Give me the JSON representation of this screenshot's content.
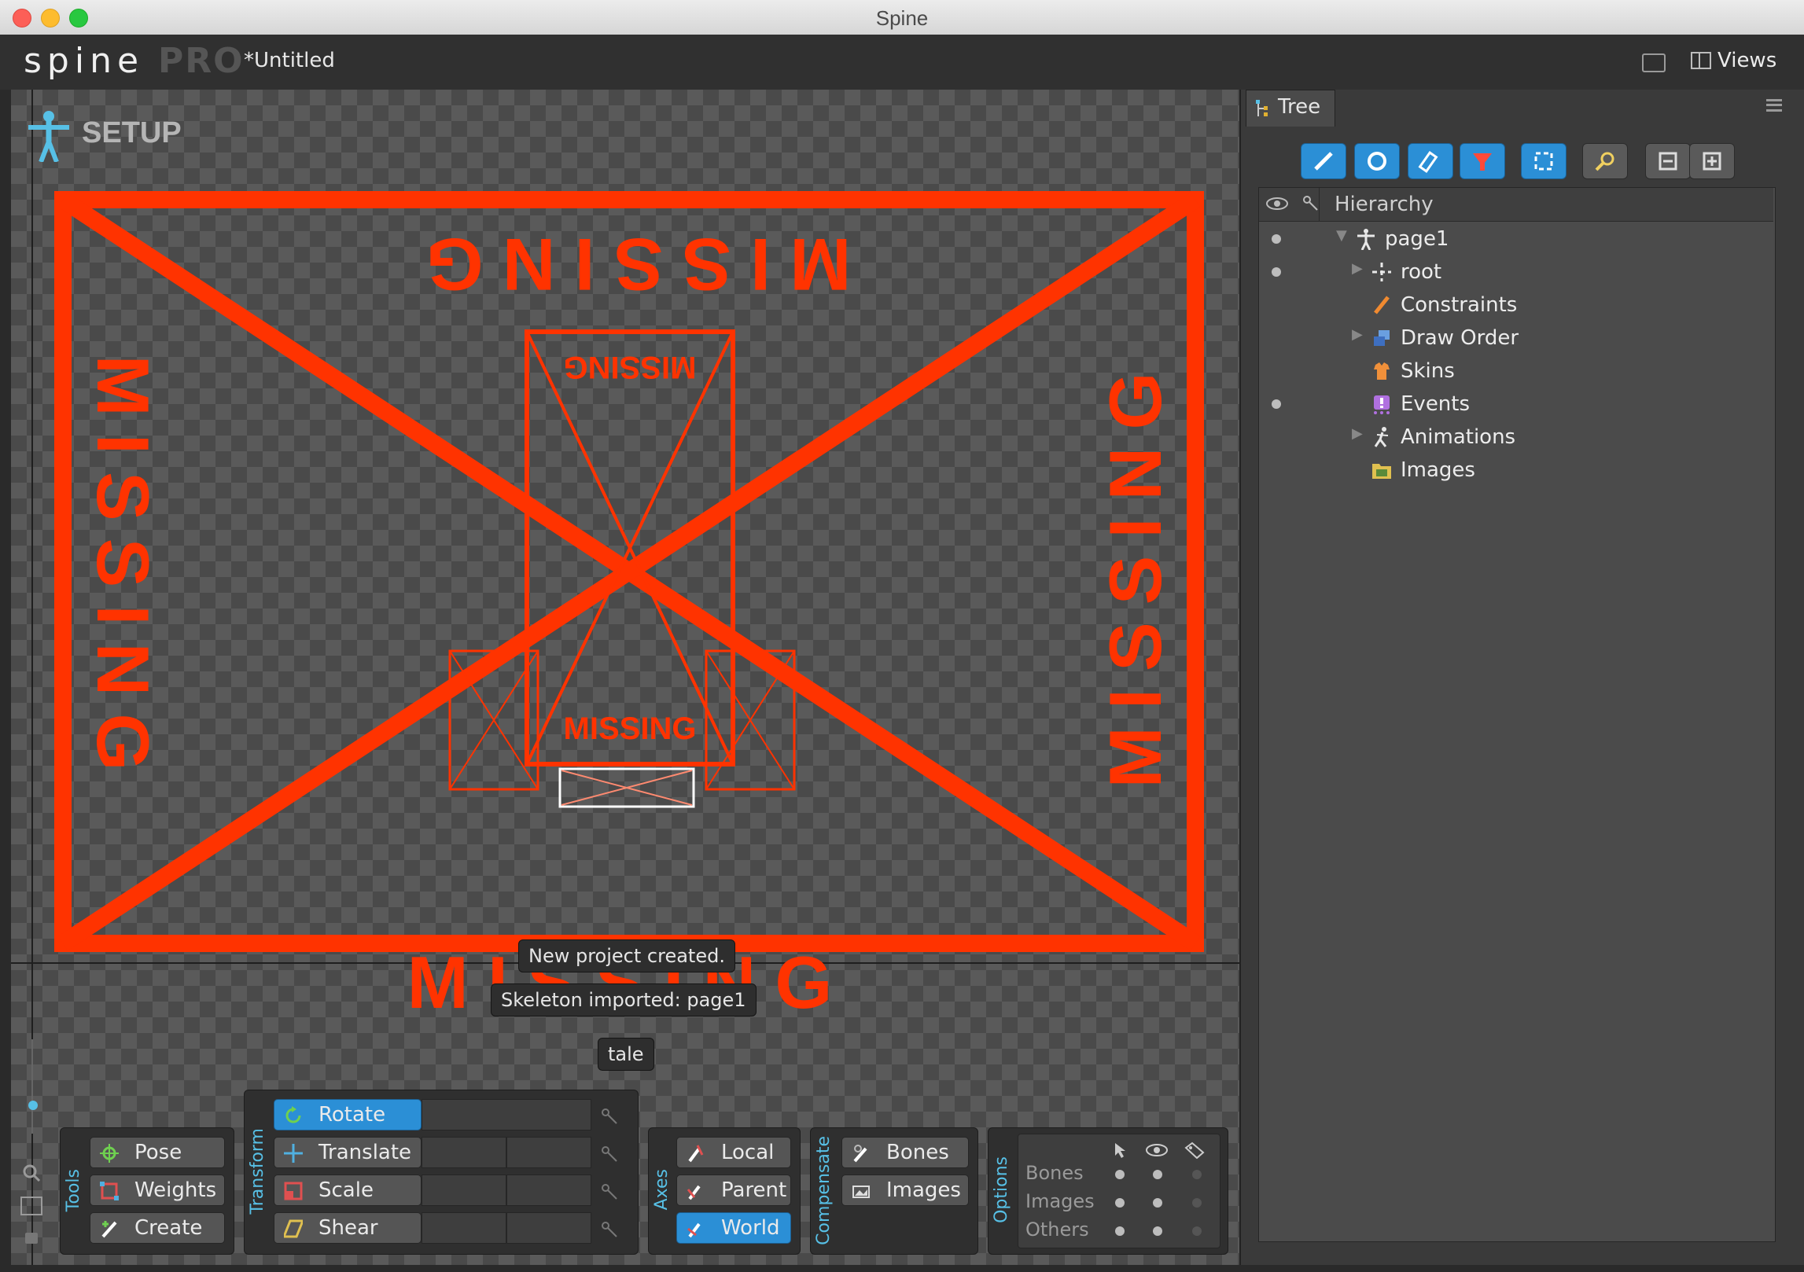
{
  "window": {
    "title": "Spine"
  },
  "app": {
    "logo_text": "spine",
    "logo_pro": "PRO",
    "document_title": "*Untitled",
    "views_label": "Views"
  },
  "viewport": {
    "mode_label": "SETUP",
    "placeholder_text": "MISSING",
    "messages": [
      "New project created.",
      "Skeleton imported: page1",
      "tale"
    ]
  },
  "tree_panel": {
    "tab_label": "Tree",
    "hierarchy_header": "Hierarchy",
    "items": [
      {
        "label": "page1",
        "icon": "skeleton-icon",
        "visible_dot": true,
        "expanded": true
      },
      {
        "label": "root",
        "icon": "bone-icon",
        "visible_dot": true,
        "has_children": true
      },
      {
        "label": "Constraints",
        "icon": "constraints-icon",
        "visible_dot": false
      },
      {
        "label": "Draw Order",
        "icon": "draw-order-icon",
        "visible_dot": false,
        "has_children": true
      },
      {
        "label": "Skins",
        "icon": "skins-icon",
        "visible_dot": false
      },
      {
        "label": "Events",
        "icon": "events-icon",
        "visible_dot": true
      },
      {
        "label": "Animations",
        "icon": "animations-icon",
        "visible_dot": false,
        "has_children": true
      },
      {
        "label": "Images",
        "icon": "images-folder-icon",
        "visible_dot": false
      }
    ]
  },
  "tools": {
    "group_label": "Tools",
    "pose": "Pose",
    "weights": "Weights",
    "create": "Create"
  },
  "transform": {
    "group_label": "Transform",
    "rotate": "Rotate",
    "translate": "Translate",
    "scale": "Scale",
    "shear": "Shear",
    "active": "Rotate"
  },
  "axes": {
    "group_label": "Axes",
    "local": "Local",
    "parent": "Parent",
    "world": "World",
    "active": "World"
  },
  "compensate": {
    "group_label": "Compensate",
    "bones": "Bones",
    "images": "Images"
  },
  "options": {
    "group_label": "Options",
    "bones": "Bones",
    "images": "Images",
    "others": "Others"
  },
  "colors": {
    "accent": "#2b8fd6",
    "missing_red": "#ff3300",
    "panel": "#3a3a3a",
    "label_cyan": "#57c0e6"
  }
}
